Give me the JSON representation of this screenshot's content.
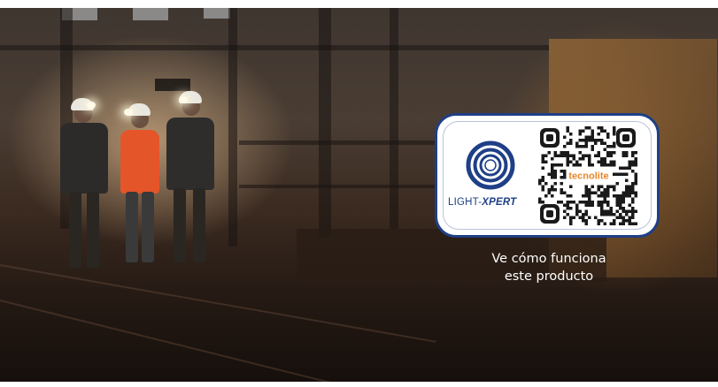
{
  "image": {
    "description_icon": "industrial-warehouse-photo-icon"
  },
  "qr_card": {
    "brand_prefix": "LIGHT-",
    "brand_suffix": "XPERT",
    "qr_center_logo": "tecnolite",
    "brand_color": "#1f3f86",
    "accent_color": "#e8872a"
  },
  "caption": {
    "line1": "Ve cómo funciona",
    "line2": "este producto"
  }
}
